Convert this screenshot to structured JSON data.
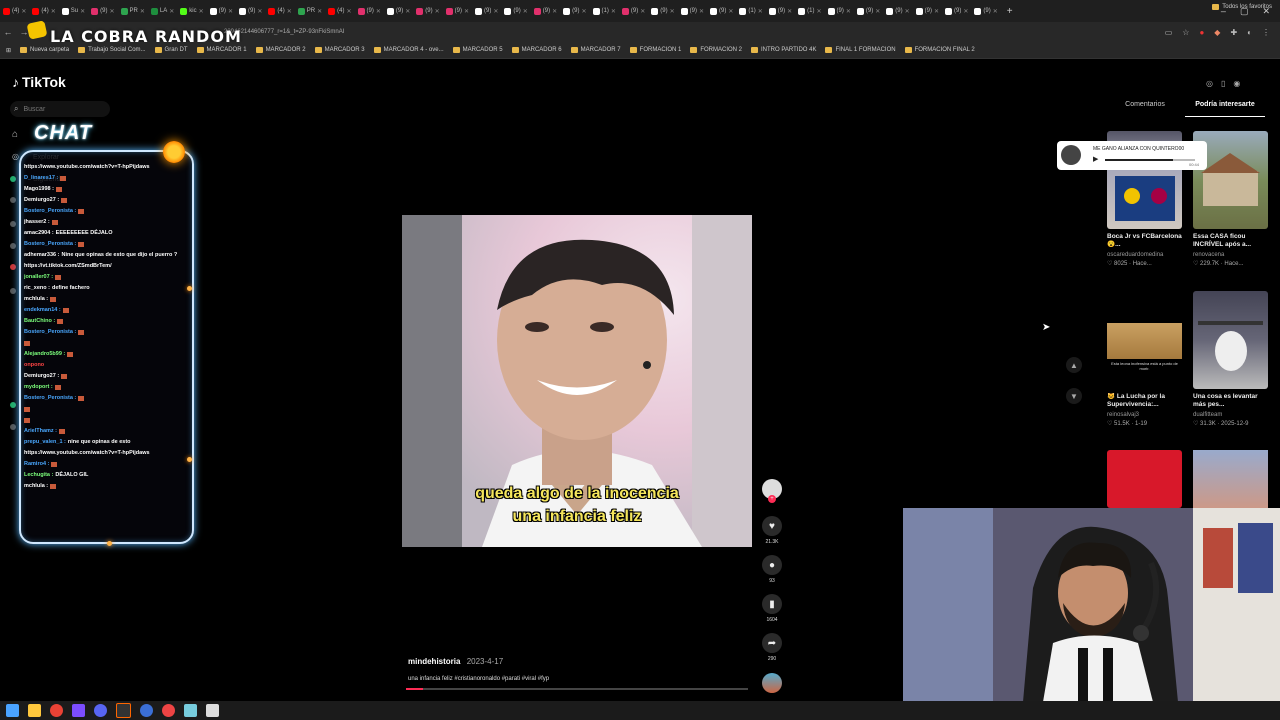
{
  "browser": {
    "tabs": [
      {
        "label": "(4)",
        "color": "#ff0000"
      },
      {
        "label": "(4)",
        "color": "#ff0000"
      },
      {
        "label": "Su",
        "color": "#ffffff"
      },
      {
        "label": "(9)",
        "color": "#e1306c"
      },
      {
        "label": "PR",
        "color": "#2ea44f"
      },
      {
        "label": "LA",
        "color": "#1e8e3e"
      },
      {
        "label": "kic",
        "color": "#53fc18"
      },
      {
        "label": "(9)",
        "color": "#ffffff"
      },
      {
        "label": "(9)",
        "color": "#ffffff"
      },
      {
        "label": "(4)",
        "color": "#ff0000"
      },
      {
        "label": "PR",
        "color": "#2ea44f"
      },
      {
        "label": "(4)",
        "color": "#ff0000"
      },
      {
        "label": "(9)",
        "color": "#e1306c"
      },
      {
        "label": "(9)",
        "color": "#ffffff"
      },
      {
        "label": "(9)",
        "color": "#e1306c"
      },
      {
        "label": "(9)",
        "color": "#e1306c"
      },
      {
        "label": "(9)",
        "color": "#ffffff"
      },
      {
        "label": "(9)",
        "color": "#ffffff"
      },
      {
        "label": "(9)",
        "color": "#e1306c"
      },
      {
        "label": "(9)",
        "color": "#ffffff"
      },
      {
        "label": "(1)",
        "color": "#ffffff"
      },
      {
        "label": "(9)",
        "color": "#e1306c"
      },
      {
        "label": "(9)",
        "color": "#ffffff"
      },
      {
        "label": "(9)",
        "color": "#ffffff"
      },
      {
        "label": "(9)",
        "color": "#ffffff"
      },
      {
        "label": "(1)",
        "color": "#ffffff"
      },
      {
        "label": "(9)",
        "color": "#ffffff"
      },
      {
        "label": "(1)",
        "color": "#ffffff"
      },
      {
        "label": "(9)",
        "color": "#ffffff"
      },
      {
        "label": "(9)",
        "color": "#ffffff"
      },
      {
        "label": "(9)",
        "color": "#ffffff"
      },
      {
        "label": "(9)",
        "color": "#ffffff"
      },
      {
        "label": "(9)",
        "color": "#ffffff"
      },
      {
        "label": "(9)",
        "color": "#ffffff"
      }
    ],
    "new_tab": "+",
    "window_controls": {
      "minimize": "–",
      "maximize": "▢",
      "close": "✕"
    },
    "url": "239462144606777_r=1&_t=ZP-93nFkiSmnAI",
    "overlay_logo": "LA COBRA RANDOM",
    "bookmarks": [
      "Nueva carpeta",
      "Trabajo Social Com...",
      "Gran DT",
      "MARCADOR 1",
      "MARCADOR 2",
      "MARCADOR 3",
      "MARCADOR 4 - ove...",
      "MARCADOR 5",
      "MARCADOR 6",
      "MARCADOR 7",
      "FORMACION 1",
      "FORMACION 2",
      "INTRO PARTIDO 4K",
      "FINAL 1 FORMACION",
      "FORMACION FINAL 2"
    ],
    "bookmarks_right": "Todos los favoritos"
  },
  "tiktok": {
    "logo": "TikTok",
    "search_placeholder": "Buscar",
    "nav": {
      "explore": "Explorar",
      "following": "Siguiendo"
    }
  },
  "chat": {
    "title": "CHAT",
    "lines": [
      {
        "user": "",
        "msg": "https://www.youtube.com/watch?v=T-hpPijdaws",
        "color": "#ffffff"
      },
      {
        "user": "D_linares17 :",
        "msg": "",
        "color": "#4aa8ff"
      },
      {
        "user": "Mago1998 :",
        "msg": "",
        "color": "#ffffff"
      },
      {
        "user": "Demiurgo27 :",
        "msg": "",
        "color": "#ffffff"
      },
      {
        "user": "Bostero_Peronista :",
        "msg": "",
        "color": "#4aa8ff"
      },
      {
        "user": "jhasser2 :",
        "msg": "",
        "color": "#ffffff"
      },
      {
        "user": "amac2904 :",
        "msg": "EEEEEEEEE DÉJALO",
        "color": "#ffffff"
      },
      {
        "user": "Bostero_Peronista :",
        "msg": "",
        "color": "#4aa8ff"
      },
      {
        "user": "adhemar336 :",
        "msg": "Nine que opinas de esto que dijo el puerro ?",
        "color": "#ffffff"
      },
      {
        "user": "",
        "msg": "https://vt.tiktok.com/ZSmdBrTem/",
        "color": "#ffffff"
      },
      {
        "user": "jonaller07 :",
        "msg": "",
        "color": "#7cff7c"
      },
      {
        "user": "ric_xeno :",
        "msg": "define fachero",
        "color": "#ffffff"
      },
      {
        "user": "mchlula :",
        "msg": "",
        "color": "#ffffff"
      },
      {
        "user": "endekman14 :",
        "msg": "",
        "color": "#4aa8ff"
      },
      {
        "user": "BautChino :",
        "msg": "",
        "color": "#7cff7c"
      },
      {
        "user": "Bostero_Peronista :",
        "msg": "",
        "color": "#4aa8ff"
      },
      {
        "user": "",
        "msg": "",
        "color": "#ff4444"
      },
      {
        "user": "Alejandro5b99 :",
        "msg": "",
        "color": "#7cff7c"
      },
      {
        "user": "",
        "msg": "onpono",
        "color": "#ff4444"
      },
      {
        "user": "Demiurgo27 :",
        "msg": "",
        "color": "#ffffff"
      },
      {
        "user": "mydoport :",
        "msg": "",
        "color": "#7cff7c"
      },
      {
        "user": "Bostero_Peronista :",
        "msg": "",
        "color": "#4aa8ff"
      },
      {
        "user": "",
        "msg": "",
        "color": "#ff4444"
      },
      {
        "user": "",
        "msg": "",
        "color": "#ff4444"
      },
      {
        "user": "ArielThamz :",
        "msg": "",
        "color": "#4aa8ff"
      },
      {
        "user": "prepu_valen_1 :",
        "msg": "nine que opinas de esto",
        "color": "#4aa8ff"
      },
      {
        "user": "",
        "msg": "https://www.youtube.com/watch?v=T-hpPijdaws",
        "color": "#ffffff"
      },
      {
        "user": "Ramiro4 :",
        "msg": "",
        "color": "#4aa8ff"
      },
      {
        "user": "Lechugita :",
        "msg": "DÉJALO GIL",
        "color": "#7cff7c"
      },
      {
        "user": "mchlula :",
        "msg": "",
        "color": "#ffffff"
      }
    ]
  },
  "video": {
    "subtitle_line1": "queda algo de la inocencia",
    "subtitle_line2": "una infancia feliz",
    "progress": 0.05
  },
  "actions": {
    "likes": "21.3K",
    "comments": "93",
    "saves": "1604",
    "shares": "290"
  },
  "post": {
    "author": "mindehistoria",
    "date": "2023-4-17",
    "caption": "una infancia feliz #cristianoronaldo #parati #viral #fyp"
  },
  "right_panel": {
    "tabs": [
      "Comentarios",
      "Podría interesarte"
    ],
    "active_tab": 1,
    "cards": [
      {
        "title": "Boca Jr vs FCBarcelona 😮...",
        "user": "oscareduardomedina",
        "stat": "8025 · Hace..."
      },
      {
        "title": "Essa CASA ficou INCRÍVEL após a...",
        "user": "renovacena",
        "stat": "229.7K · Hace..."
      },
      {
        "title": "😺 La Lucha por la Supervivencia:...",
        "user": "reinosalvaj3",
        "stat": "51.5K · 1-19"
      },
      {
        "title": "Una cosa es levantar más pes...",
        "user": "dualfitteam",
        "stat": "31.3K · 2025-12-9"
      }
    ],
    "thumb_text": "Esta leona inofensiva está a punto de morir."
  },
  "music": {
    "title": "ME GANO ALIANZA CON QUINTERO00",
    "time": "00:44",
    "progress": 0.75
  }
}
